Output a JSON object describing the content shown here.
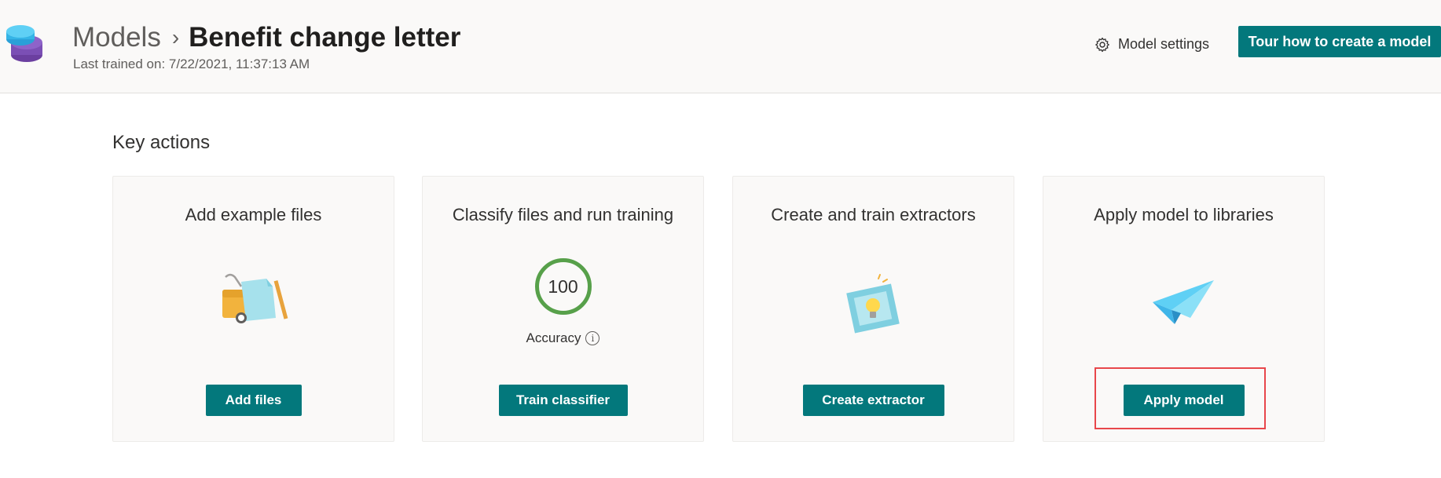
{
  "header": {
    "breadcrumb_root": "Models",
    "breadcrumb_separator": "›",
    "title": "Benefit change letter",
    "subtitle": "Last trained on: 7/22/2021, 11:37:13 AM",
    "settings_icon": "gear-icon",
    "settings_label": "Model settings",
    "tour_label": "Tour how to create a model"
  },
  "section_title": "Key actions",
  "cards": [
    {
      "title": "Add example files",
      "icon": "files-illustration",
      "button": "Add files"
    },
    {
      "title": "Classify files and run training",
      "accuracy_value": "100",
      "accuracy_label": "Accuracy",
      "info_glyph": "i",
      "button": "Train classifier"
    },
    {
      "title": "Create and train extractors",
      "icon": "lightbulb-illustration",
      "button": "Create extractor"
    },
    {
      "title": "Apply model to libraries",
      "icon": "paper-plane-illustration",
      "button": "Apply model"
    }
  ],
  "colors": {
    "accent": "#03787c",
    "accuracy_ring": "#57a04a",
    "highlight": "#e8474b"
  }
}
